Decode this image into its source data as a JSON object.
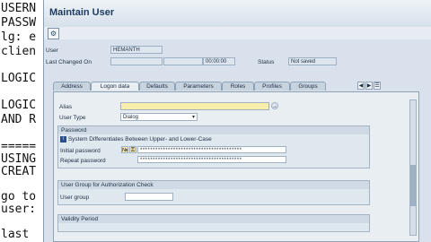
{
  "background_text": [
    "USERN",
    "PASSW",
    "lg: e",
    "clien",
    "LOGIC",
    "LOGIC",
    "AND R",
    "=====",
    "USING",
    "CREAT",
    "go to",
    "user:",
    "last"
  ],
  "window": {
    "title": "Maintain User"
  },
  "header": {
    "user_label": "User",
    "user_value": "HEMANTH",
    "last_changed_label": "Last Changed On",
    "last_changed_time": "00:00:00",
    "status_label": "Status",
    "status_value": "Not saved"
  },
  "tabs": [
    "Address",
    "Logon data",
    "Defaults",
    "Parameters",
    "Roles",
    "Profiles",
    "Groups"
  ],
  "active_tab": "Logon data",
  "logon": {
    "alias_label": "Alias",
    "alias_value": "",
    "user_type_label": "User Type",
    "user_type_value": "Dialog",
    "password_group": "Password",
    "case_note": "System Differentiates Between Upper- and Lower-Case",
    "initial_password_label": "Initial password",
    "initial_password_value": "****************************************",
    "repeat_password_label": "Repeat password",
    "repeat_password_value": "****************************************",
    "auth_group": "User Group for Authorization Check",
    "user_group_label": "User group",
    "user_group_value": "",
    "validity_group": "Validity Period"
  },
  "colors": {
    "accent": "#1e3a5f",
    "alias_field": "#f7eeaa",
    "panel": "#e9eef3"
  }
}
